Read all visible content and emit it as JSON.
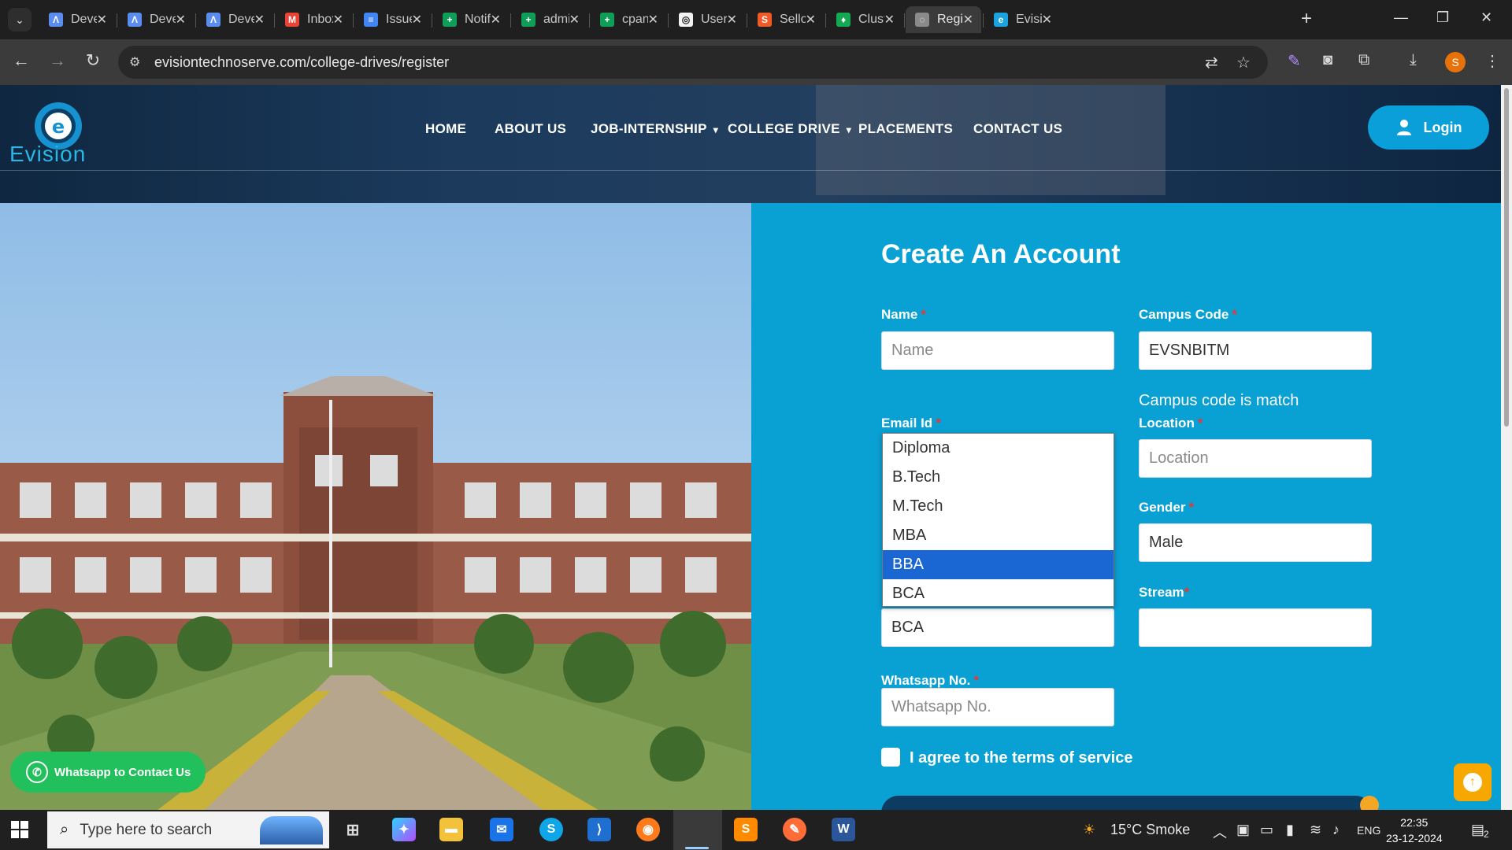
{
  "browser": {
    "tabs": [
      {
        "title": "Deve",
        "favicon": "ai-icon",
        "color": "#5a8dee"
      },
      {
        "title": "Deve",
        "favicon": "ai-icon",
        "color": "#5a8dee"
      },
      {
        "title": "Deve",
        "favicon": "ai-icon",
        "color": "#5a8dee"
      },
      {
        "title": "Inbox",
        "favicon": "gmail-icon",
        "color": "#ea4335"
      },
      {
        "title": "Issue",
        "favicon": "docs-icon",
        "color": "#4285f4"
      },
      {
        "title": "Notif",
        "favicon": "sheets-icon",
        "color": "#0f9d58"
      },
      {
        "title": "admi",
        "favicon": "sheets-icon",
        "color": "#0f9d58"
      },
      {
        "title": "cpan",
        "favicon": "sheets-icon",
        "color": "#0f9d58"
      },
      {
        "title": "User",
        "favicon": "openai-icon",
        "color": "#f2f2f2"
      },
      {
        "title": "Sello",
        "favicon": "sellodrive-icon",
        "color": "#f05a28"
      },
      {
        "title": "Clust",
        "favicon": "mongodb-icon",
        "color": "#13aa52"
      },
      {
        "title": "Regi",
        "favicon": "globe-icon",
        "color": "#8a8a8a"
      },
      {
        "title": "Evisio",
        "favicon": "evision-icon",
        "color": "#1aa3df"
      }
    ],
    "active_tab_index": 11,
    "url": "evisiontechnoserve.com/college-drives/register",
    "profile_initial": "S"
  },
  "site": {
    "logo_text": "Evision",
    "nav": [
      {
        "label": "HOME",
        "has_caret": false
      },
      {
        "label": "ABOUT US",
        "has_caret": false
      },
      {
        "label": "JOB-INTERNSHIP",
        "has_caret": true
      },
      {
        "label": "COLLEGE DRIVE",
        "has_caret": true
      },
      {
        "label": "PLACEMENTS",
        "has_caret": false
      },
      {
        "label": "CONTACT US",
        "has_caret": false
      }
    ],
    "login_label": "Login"
  },
  "form": {
    "title": "Create An Account",
    "name": {
      "label": "Name",
      "placeholder": "Name",
      "value": ""
    },
    "campus_code": {
      "label": "Campus Code",
      "value": "EVSNBITM"
    },
    "campus_hint": "Campus code is match",
    "email": {
      "label": "Email Id"
    },
    "location": {
      "label": "Location",
      "placeholder": "Location",
      "value": ""
    },
    "gender": {
      "label": "Gender",
      "value": "Male"
    },
    "stream": {
      "label": "Stream",
      "value": ""
    },
    "course": {
      "value": "BCA"
    },
    "course_options": [
      "Diploma",
      "B.Tech",
      "M.Tech",
      "MBA",
      "BBA",
      "BCA"
    ],
    "highlighted_option": "BBA",
    "whatsapp": {
      "label": "Whatsapp No.",
      "placeholder": "Whatsapp No.",
      "value": ""
    },
    "agree_label": "I agree to the terms of service",
    "required_mark": "*"
  },
  "floating": {
    "whatsapp_label": "Whatsapp to Contact Us"
  },
  "taskbar": {
    "search_placeholder": "Type here to search",
    "weather": "15°C  Smoke",
    "language": "ENG",
    "time": "22:35",
    "date": "23-12-2024",
    "notification_count": "2"
  },
  "colors": {
    "brand_blue": "#09a0d3",
    "login_blue": "#0a9fd8",
    "whatsapp_green": "#21c05c",
    "scroll_top_orange": "#f6a800",
    "required_red": "#e53935"
  }
}
